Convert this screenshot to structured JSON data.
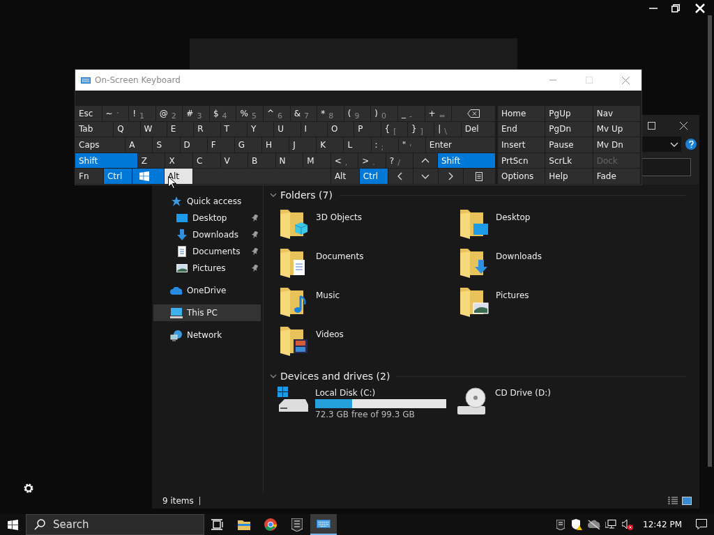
{
  "keyboard": {
    "title": "On-Screen Keyboard",
    "main_rows": [
      [
        {
          "kind": "text",
          "label": "Esc",
          "on": false,
          "pressed": false
        },
        {
          "kind": "text",
          "label": "~",
          "sub": "`",
          "on": false,
          "pressed": false
        },
        {
          "kind": "text",
          "label": "!",
          "sub": "1",
          "on": false,
          "pressed": false
        },
        {
          "kind": "text",
          "label": "@",
          "sub": "2",
          "on": false,
          "pressed": false
        },
        {
          "kind": "text",
          "label": "#",
          "sub": "3",
          "on": false,
          "pressed": false
        },
        {
          "kind": "text",
          "label": "$",
          "sub": "4",
          "on": false,
          "pressed": false
        },
        {
          "kind": "text",
          "label": "%",
          "sub": "5",
          "on": false,
          "pressed": false
        },
        {
          "kind": "text",
          "label": "^",
          "sub": "6",
          "on": false,
          "pressed": false
        },
        {
          "kind": "text",
          "label": "&",
          "sub": "7",
          "on": false,
          "pressed": false
        },
        {
          "kind": "text",
          "label": "*",
          "sub": "8",
          "on": false,
          "pressed": false
        },
        {
          "kind": "text",
          "label": "(",
          "sub": "9",
          "on": false,
          "pressed": false
        },
        {
          "kind": "text",
          "label": ")",
          "sub": "0",
          "on": false,
          "pressed": false
        },
        {
          "kind": "text",
          "label": "_",
          "sub": "-",
          "on": false,
          "pressed": false
        },
        {
          "kind": "text",
          "label": "+",
          "sub": "=",
          "on": false,
          "pressed": false
        },
        {
          "kind": "icon",
          "on": false,
          "pressed": false
        }
      ],
      [
        {
          "kind": "text",
          "label": "Tab",
          "on": false,
          "pressed": false
        },
        {
          "kind": "text",
          "label": "Q",
          "on": false,
          "pressed": false
        },
        {
          "kind": "text",
          "label": "W",
          "on": false,
          "pressed": false
        },
        {
          "kind": "text",
          "label": "E",
          "on": false,
          "pressed": false
        },
        {
          "kind": "text",
          "label": "R",
          "on": false,
          "pressed": false
        },
        {
          "kind": "text",
          "label": "T",
          "on": false,
          "pressed": false
        },
        {
          "kind": "text",
          "label": "Y",
          "on": false,
          "pressed": false
        },
        {
          "kind": "text",
          "label": "U",
          "on": false,
          "pressed": false
        },
        {
          "kind": "text",
          "label": "I",
          "on": false,
          "pressed": false
        },
        {
          "kind": "text",
          "label": "O",
          "on": false,
          "pressed": false
        },
        {
          "kind": "text",
          "label": "P",
          "on": false,
          "pressed": false
        },
        {
          "kind": "text",
          "label": "{",
          "sub": "[",
          "on": false,
          "pressed": false
        },
        {
          "kind": "text",
          "label": "}",
          "sub": "]",
          "on": false,
          "pressed": false
        },
        {
          "kind": "text",
          "label": "|",
          "sub": "\\",
          "on": false,
          "pressed": false
        },
        {
          "kind": "text",
          "label": "Del",
          "on": false,
          "pressed": false
        }
      ],
      [
        {
          "kind": "text",
          "label": "Caps",
          "on": false,
          "pressed": false
        },
        {
          "kind": "text",
          "label": "A",
          "on": false,
          "pressed": false
        },
        {
          "kind": "text",
          "label": "S",
          "on": false,
          "pressed": false
        },
        {
          "kind": "text",
          "label": "D",
          "on": false,
          "pressed": false
        },
        {
          "kind": "text",
          "label": "F",
          "on": false,
          "pressed": false
        },
        {
          "kind": "text",
          "label": "G",
          "on": false,
          "pressed": false
        },
        {
          "kind": "text",
          "label": "H",
          "on": false,
          "pressed": false
        },
        {
          "kind": "text",
          "label": "J",
          "on": false,
          "pressed": false
        },
        {
          "kind": "text",
          "label": "K",
          "on": false,
          "pressed": false
        },
        {
          "kind": "text",
          "label": "L",
          "on": false,
          "pressed": false
        },
        {
          "kind": "text",
          "label": ":",
          "sub": ";",
          "on": false,
          "pressed": false
        },
        {
          "kind": "text",
          "label": "\"",
          "sub": "'",
          "on": false,
          "pressed": false
        },
        {
          "kind": "text",
          "label": "Enter",
          "on": false,
          "pressed": false
        }
      ],
      [
        {
          "kind": "text",
          "label": "Shift",
          "on": true,
          "pressed": false
        },
        {
          "kind": "text",
          "label": "Z",
          "on": false,
          "pressed": false
        },
        {
          "kind": "text",
          "label": "X",
          "on": false,
          "pressed": false
        },
        {
          "kind": "text",
          "label": "C",
          "on": false,
          "pressed": false
        },
        {
          "kind": "text",
          "label": "V",
          "on": false,
          "pressed": false
        },
        {
          "kind": "text",
          "label": "B",
          "on": false,
          "pressed": false
        },
        {
          "kind": "text",
          "label": "N",
          "on": false,
          "pressed": false
        },
        {
          "kind": "text",
          "label": "M",
          "on": false,
          "pressed": false
        },
        {
          "kind": "text",
          "label": "<",
          "sub": ",",
          "on": false,
          "pressed": false
        },
        {
          "kind": "text",
          "label": ">",
          "sub": ".",
          "on": false,
          "pressed": false
        },
        {
          "kind": "text",
          "label": "?",
          "sub": "/",
          "on": false,
          "pressed": false
        },
        {
          "kind": "icon",
          "on": false,
          "pressed": false
        },
        {
          "kind": "text",
          "label": "Shift",
          "on": true,
          "pressed": false
        }
      ],
      [
        {
          "kind": "text",
          "label": "Fn",
          "on": false,
          "pressed": false
        },
        {
          "kind": "text",
          "label": "Ctrl",
          "on": true,
          "pressed": false
        },
        {
          "kind": "icon",
          "on": true,
          "pressed": false
        },
        {
          "kind": "text",
          "label": "Alt",
          "on": false,
          "pressed": true
        },
        {
          "kind": "blank",
          "on": false,
          "pressed": false
        },
        {
          "kind": "text",
          "label": "Alt",
          "on": false,
          "pressed": false
        },
        {
          "kind": "text",
          "label": "Ctrl",
          "on": true,
          "pressed": false
        },
        {
          "kind": "icon",
          "on": false,
          "pressed": false
        },
        {
          "kind": "icon",
          "on": false,
          "pressed": false
        },
        {
          "kind": "icon",
          "on": false,
          "pressed": false
        },
        {
          "kind": "icon",
          "on": false,
          "pressed": false
        }
      ]
    ],
    "side_rows": [
      [
        {
          "label": "Home",
          "disabled": false
        },
        {
          "label": "PgUp",
          "disabled": false
        },
        {
          "label": "Nav",
          "disabled": false
        }
      ],
      [
        {
          "label": "End",
          "disabled": false
        },
        {
          "label": "PgDn",
          "disabled": false
        },
        {
          "label": "Mv Up",
          "disabled": false
        }
      ],
      [
        {
          "label": "Insert",
          "disabled": false
        },
        {
          "label": "Pause",
          "disabled": false
        },
        {
          "label": "Mv Dn",
          "disabled": false
        }
      ],
      [
        {
          "label": "PrtScn",
          "disabled": false
        },
        {
          "label": "ScrLk",
          "disabled": false
        },
        {
          "label": "Dock",
          "disabled": true
        }
      ],
      [
        {
          "label": "Options",
          "disabled": false
        },
        {
          "label": "Help",
          "disabled": false
        },
        {
          "label": "Fade",
          "disabled": false
        }
      ]
    ]
  },
  "explorer": {
    "nav": [
      {
        "label": "Quick access",
        "selected": false,
        "children": [
          {
            "label": "Desktop",
            "pinned": true,
            "selected": false
          },
          {
            "label": "Downloads",
            "pinned": true,
            "selected": false
          },
          {
            "label": "Documents",
            "pinned": true,
            "selected": false
          },
          {
            "label": "Pictures",
            "pinned": true,
            "selected": false
          }
        ]
      },
      {
        "label": "OneDrive",
        "selected": false
      },
      {
        "label": "This PC",
        "selected": true
      },
      {
        "label": "Network",
        "selected": false
      }
    ],
    "groups": [
      {
        "title": "Folders (7)",
        "expanded": true,
        "kind": "folders",
        "items": [
          {
            "name": "3D Objects"
          },
          {
            "name": "Desktop"
          },
          {
            "name": "Documents"
          },
          {
            "name": "Downloads"
          },
          {
            "name": "Music"
          },
          {
            "name": "Pictures"
          },
          {
            "name": "Videos"
          }
        ]
      },
      {
        "title": "Devices and drives (2)",
        "expanded": true,
        "kind": "drives",
        "items": [
          {
            "kind": "disk",
            "name": "Local Disk (C:)",
            "level": 0.28,
            "free": "72.3 GB free of 99.3 GB"
          },
          {
            "kind": "cd",
            "name": "CD Drive (D:)"
          }
        ]
      }
    ],
    "status": "9 items"
  },
  "taskbar": {
    "search_placeholder": "Search",
    "apps": [
      {
        "selected": false
      },
      {
        "selected": false
      },
      {
        "selected": false
      },
      {
        "selected": true
      }
    ],
    "clock": "12:42 PM"
  }
}
